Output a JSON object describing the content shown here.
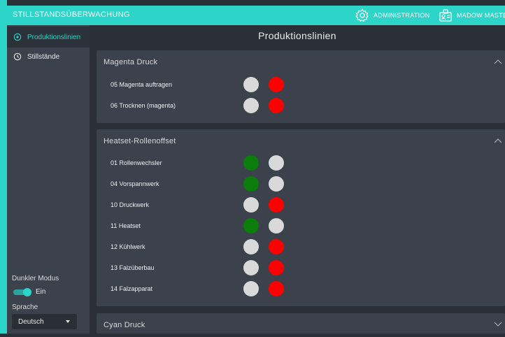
{
  "header": {
    "title": "STILLSTANDSÜBERWACHUNG",
    "admin_label": "ADMINISTRATION",
    "user_label": "MADOW MASTER"
  },
  "sidebar": {
    "items": [
      {
        "label": "Produktionslinien",
        "icon": "target-icon",
        "active": true
      },
      {
        "label": "Stillstände",
        "icon": "clock-icon",
        "active": false
      }
    ],
    "dark_mode_label": "Dunkler Modus",
    "dark_mode_value": "Ein",
    "language_label": "Sprache",
    "language_value": "Deutsch"
  },
  "main": {
    "title": "Produktionslinien",
    "panels": [
      {
        "title": "Magenta Druck",
        "expanded": true,
        "rows": [
          {
            "name": "05 Magenta auftragen",
            "status": [
              "gray",
              "red"
            ]
          },
          {
            "name": "06 Trocknen (magenta)",
            "status": [
              "gray",
              "red"
            ]
          }
        ]
      },
      {
        "title": "Heatset-Rollenoffset",
        "expanded": true,
        "rows": [
          {
            "name": "01 Rollenwechsler",
            "status": [
              "green",
              "gray"
            ]
          },
          {
            "name": "04 Vorspannwerk",
            "status": [
              "green",
              "gray"
            ]
          },
          {
            "name": "10 Druckwerk",
            "status": [
              "gray",
              "red"
            ]
          },
          {
            "name": "11 Heatset",
            "status": [
              "green",
              "gray"
            ]
          },
          {
            "name": "12 Kühlwerk",
            "status": [
              "gray",
              "red"
            ]
          },
          {
            "name": "13 Falzüberbau",
            "status": [
              "gray",
              "red"
            ]
          },
          {
            "name": "14 Falzapparat",
            "status": [
              "gray",
              "red"
            ]
          }
        ]
      },
      {
        "title": "Cyan Druck",
        "expanded": false,
        "rows": []
      }
    ]
  },
  "colors": {
    "accent": "#2dd4c8",
    "green": "#0a7d0a",
    "red": "#ff0000",
    "gray": "#d9d9d9"
  }
}
